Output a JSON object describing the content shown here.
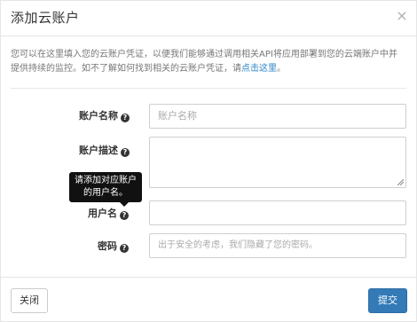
{
  "dialog": {
    "title": "添加云账户",
    "close_glyph": "×"
  },
  "description": {
    "text": "您可以在这里填入您的云账户凭证，以便我们能够通过调用相关API将应用部署到您的云端账户中并提供持续的监控。如不了解如何找到相关的云账户凭证，请",
    "link_text": "点击这里",
    "tail": "。"
  },
  "form": {
    "account_name": {
      "label": "账户名称",
      "placeholder": "账户名称",
      "value": ""
    },
    "account_desc": {
      "label": "账户描述",
      "value": ""
    },
    "username": {
      "label": "用户名",
      "value": ""
    },
    "password": {
      "label": "密码",
      "placeholder": "出于安全的考虑，我们隐藏了您的密码。",
      "value": ""
    },
    "help_glyph": "?"
  },
  "tooltip": {
    "line1": "请添加对应账户",
    "line2": "的用户名。"
  },
  "footer": {
    "close_label": "关闭",
    "submit_label": "提交"
  },
  "colors": {
    "primary": "#337ab7",
    "link": "#2a84c6",
    "tooltip_bg": "#111111"
  }
}
